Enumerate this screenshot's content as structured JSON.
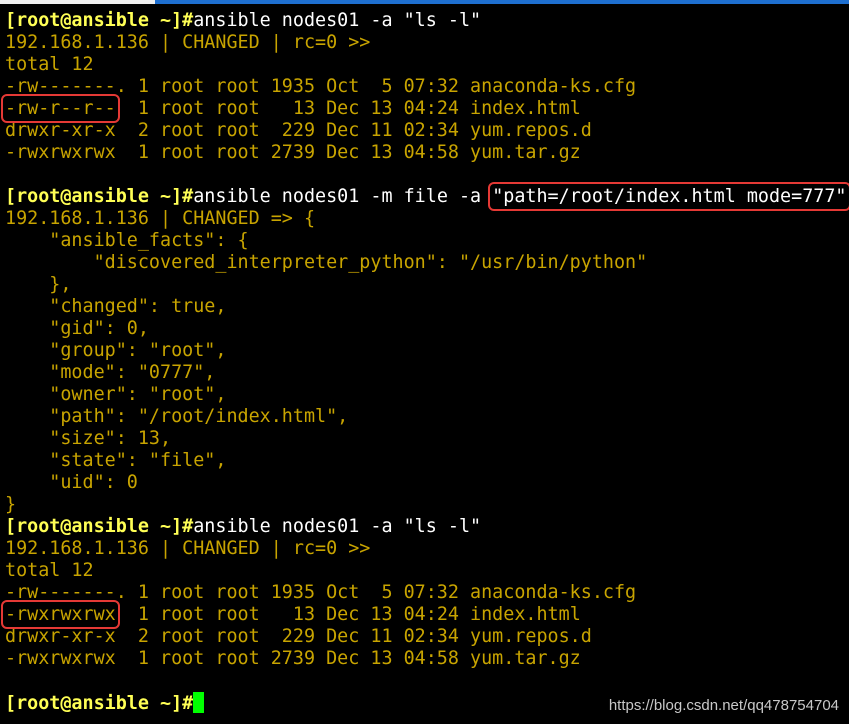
{
  "colors": {
    "prompt": "#ffff55",
    "command": "#ffffff",
    "output": "#c8a400",
    "highlight_box": "#e53935",
    "cursor": "#00ff00",
    "background": "#000000"
  },
  "lines": [
    [
      {
        "t": "[root@ansible ~]#",
        "s": "prompt"
      },
      {
        "t": "ansible nodes01 -a \"ls -l\"",
        "s": "cmd"
      }
    ],
    [
      {
        "t": "192.168.1.136 | CHANGED | rc=0 >>",
        "s": "out"
      }
    ],
    [
      {
        "t": "total 12",
        "s": "out"
      }
    ],
    [
      {
        "t": "-rw-------. 1 root root 1935 Oct  5 07:32 anaconda-ks.cfg",
        "s": "out"
      }
    ],
    [
      {
        "t": "-rw-r--r--",
        "s": "out box"
      },
      {
        "t": "  1 root root   13 Dec 13 04:24 index.html",
        "s": "out"
      }
    ],
    [
      {
        "t": "drwxr-xr-x  2 root root  229 Dec 11 02:34 yum.repos.d",
        "s": "out"
      }
    ],
    [
      {
        "t": "-rwxrwxrwx  1 root root 2739 Dec 13 04:58 yum.tar.gz",
        "s": "out"
      }
    ],
    [
      {
        "t": "",
        "s": "out"
      }
    ],
    [
      {
        "t": "[root@ansible ~]#",
        "s": "prompt"
      },
      {
        "t": "ansible nodes01 -m file -a ",
        "s": "cmd"
      },
      {
        "t": "\"path=/root/index.html mode=777\"",
        "s": "cmd box"
      }
    ],
    [
      {
        "t": "192.168.1.136 | CHANGED => {",
        "s": "out"
      }
    ],
    [
      {
        "t": "    \"ansible_facts\": {",
        "s": "out"
      }
    ],
    [
      {
        "t": "        \"discovered_interpreter_python\": \"/usr/bin/python\"",
        "s": "out"
      }
    ],
    [
      {
        "t": "    },",
        "s": "out"
      }
    ],
    [
      {
        "t": "    \"changed\": true,",
        "s": "out"
      }
    ],
    [
      {
        "t": "    \"gid\": 0,",
        "s": "out"
      }
    ],
    [
      {
        "t": "    \"group\": \"root\",",
        "s": "out"
      }
    ],
    [
      {
        "t": "    \"mode\": \"0777\",",
        "s": "out"
      }
    ],
    [
      {
        "t": "    \"owner\": \"root\",",
        "s": "out"
      }
    ],
    [
      {
        "t": "    \"path\": \"/root/index.html\",",
        "s": "out"
      }
    ],
    [
      {
        "t": "    \"size\": 13,",
        "s": "out"
      }
    ],
    [
      {
        "t": "    \"state\": \"file\",",
        "s": "out"
      }
    ],
    [
      {
        "t": "    \"uid\": 0",
        "s": "out"
      }
    ],
    [
      {
        "t": "}",
        "s": "out"
      }
    ],
    [
      {
        "t": "[root@ansible ~]#",
        "s": "prompt"
      },
      {
        "t": "ansible nodes01 -a \"ls -l\"",
        "s": "cmd"
      }
    ],
    [
      {
        "t": "192.168.1.136 | CHANGED | rc=0 >>",
        "s": "out"
      }
    ],
    [
      {
        "t": "total 12",
        "s": "out"
      }
    ],
    [
      {
        "t": "-rw-------. 1 root root 1935 Oct  5 07:32 anaconda-ks.cfg",
        "s": "out"
      }
    ],
    [
      {
        "t": "-rwxrwxrwx",
        "s": "out box"
      },
      {
        "t": "  1 root root   13 Dec 13 04:24 index.html",
        "s": "out"
      }
    ],
    [
      {
        "t": "drwxr-xr-x  2 root root  229 Dec 11 02:34 yum.repos.d",
        "s": "out"
      }
    ],
    [
      {
        "t": "-rwxrwxrwx  1 root root 2739 Dec 13 04:58 yum.tar.gz",
        "s": "out"
      }
    ],
    [
      {
        "t": "",
        "s": "out"
      }
    ],
    [
      {
        "t": "[root@ansible ~]#",
        "s": "prompt"
      },
      {
        "t": "",
        "s": "cursor"
      }
    ]
  ],
  "watermark": "https://blog.csdn.net/qq478754704"
}
